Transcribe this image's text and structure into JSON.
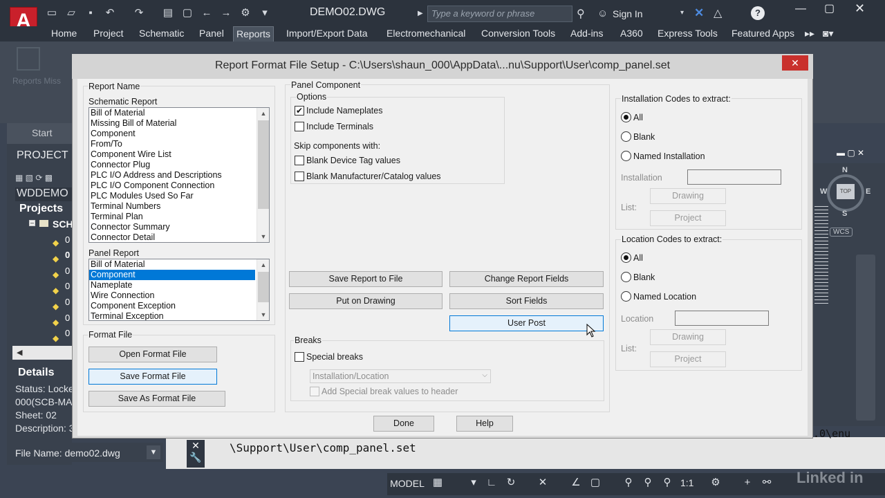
{
  "app": {
    "logo_letter": "A",
    "doc_title": "DEMO02.DWG",
    "search_placeholder": "Type a keyword or phrase",
    "sign_in": "Sign In"
  },
  "ribbon": {
    "tabs": [
      "Home",
      "Project",
      "Schematic",
      "Panel",
      "Reports",
      "Import/Export Data",
      "Electromechanical",
      "Conversion Tools",
      "Add-ins",
      "A360",
      "Express Tools",
      "Featured Apps"
    ],
    "active_tab": "Reports",
    "ghost_text": "Reports  Miss"
  },
  "project_manager": {
    "start_tab": "Start",
    "title": "PROJECT M",
    "project_name": "WDDEMO",
    "projects_label": "Projects",
    "folder_label": "SCH",
    "tree_items": [
      "0",
      "0",
      "0",
      "0",
      "0",
      "0",
      "0"
    ],
    "details_label": "Details",
    "details": [
      "Status: Locke",
      "000(SCB-MA",
      "Sheet: 02",
      "Description: 3"
    ],
    "file_name": "File Name: demo02.dwg"
  },
  "command_line": {
    "text": "\\Support\\User\\comp_panel.set",
    "right_text": ".0\\enu"
  },
  "viewcube": {
    "top": "TOP",
    "n": "N",
    "s": "S",
    "w": "W",
    "e": "E",
    "wcs": "WCS"
  },
  "status_bar": {
    "model": "MODEL",
    "scale": "1:1",
    "watermark": "Linked in"
  },
  "dialog": {
    "title": "Report Format File Setup - C:\\Users\\shaun_000\\AppData\\...nu\\Support\\User\\comp_panel.set",
    "report_name_label": "Report Name",
    "schematic_report_label": "Schematic Report",
    "schematic_reports": [
      "Bill of Material",
      "Missing Bill of Material",
      "Component",
      "From/To",
      "Component Wire List",
      "Connector Plug",
      "PLC I/O Address and Descriptions",
      "PLC I/O Component Connection",
      "PLC Modules Used So Far",
      "Terminal Numbers",
      "Terminal Plan",
      "Connector Summary",
      "Connector Detail"
    ],
    "panel_report_label": "Panel Report",
    "panel_reports": [
      "Bill of Material",
      "Component",
      "Nameplate",
      "Wire Connection",
      "Component Exception",
      "Terminal Exception"
    ],
    "panel_selected_index": 1,
    "format_file_label": "Format File",
    "open_format_file": "Open Format File",
    "save_format_file": "Save Format File",
    "save_as_format_file": "Save As Format File",
    "panel_component_label": "Panel Component",
    "options_label": "Options",
    "include_nameplates": "Include Nameplates",
    "include_terminals": "Include Terminals",
    "skip_label": "Skip components with:",
    "blank_device_tag": "Blank Device Tag values",
    "blank_mfr_catalog": "Blank Manufacturer/Catalog values",
    "save_report_to_file": "Save Report to File",
    "change_report_fields": "Change Report Fields",
    "put_on_drawing": "Put on Drawing",
    "sort_fields": "Sort Fields",
    "user_post": "User Post",
    "breaks_label": "Breaks",
    "special_breaks": "Special breaks",
    "breaks_combo": "Installation/Location",
    "add_special_break": "Add Special break values to header",
    "installation_codes_label": "Installation Codes to extract:",
    "location_codes_label": "Location Codes to extract:",
    "radio_all": "All",
    "radio_blank": "Blank",
    "named_installation": "Named Installation",
    "named_location": "Named Location",
    "installation_field_label": "Installation",
    "location_field_label": "Location",
    "list_label": "List:",
    "drawing_btn": "Drawing",
    "project_btn": "Project",
    "done": "Done",
    "help": "Help"
  }
}
